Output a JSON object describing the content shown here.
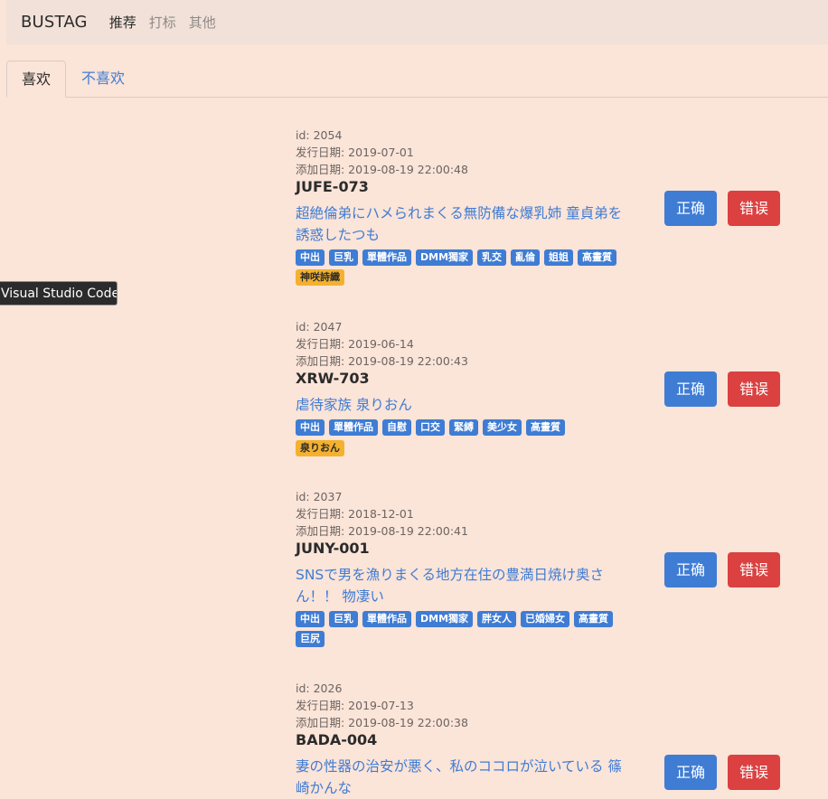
{
  "nav": {
    "brand": "BUSTAG",
    "links": [
      "推荐",
      "打标",
      "其他"
    ]
  },
  "tabs": [
    "喜欢",
    "不喜欢"
  ],
  "tooltip": "Visual Studio Code",
  "buttons": {
    "correct": "正确",
    "wrong": "错误"
  },
  "items": [
    {
      "id": "id: 2054",
      "release": "发行日期: 2019-07-01",
      "added": "添加日期: 2019-08-19 22:00:48",
      "code": "JUFE-073",
      "title": "超絶倫弟にハメられまくる無防備な爆乳姉 童貞弟を誘惑したつも",
      "tags": [
        "中出",
        "巨乳",
        "單體作品",
        "DMM獨家",
        "乳交",
        "亂倫",
        "姐姐",
        "高畫質"
      ],
      "stars": [
        "神咲詩織"
      ]
    },
    {
      "id": "id: 2047",
      "release": "发行日期: 2019-06-14",
      "added": "添加日期: 2019-08-19 22:00:43",
      "code": "XRW-703",
      "title": "虐待家族 泉りおん",
      "tags": [
        "中出",
        "單體作品",
        "自慰",
        "口交",
        "緊縛",
        "美少女",
        "高畫質"
      ],
      "stars": [
        "泉りおん"
      ]
    },
    {
      "id": "id: 2037",
      "release": "发行日期: 2018-12-01",
      "added": "添加日期: 2019-08-19 22:00:41",
      "code": "JUNY-001",
      "title": "SNSで男を漁りまくる地方在住の豊満日焼け奥さん！！ 物凄い",
      "tags": [
        "中出",
        "巨乳",
        "單體作品",
        "DMM獨家",
        "胖女人",
        "已婚婦女",
        "高畫質",
        "巨尻"
      ],
      "stars": []
    },
    {
      "id": "id: 2026",
      "release": "发行日期: 2019-07-13",
      "added": "添加日期: 2019-08-19 22:00:38",
      "code": "BADA-004",
      "title": "妻の性器の治安が悪く、私のココロが泣いている 篠崎かんな",
      "tags": [],
      "stars": []
    }
  ]
}
